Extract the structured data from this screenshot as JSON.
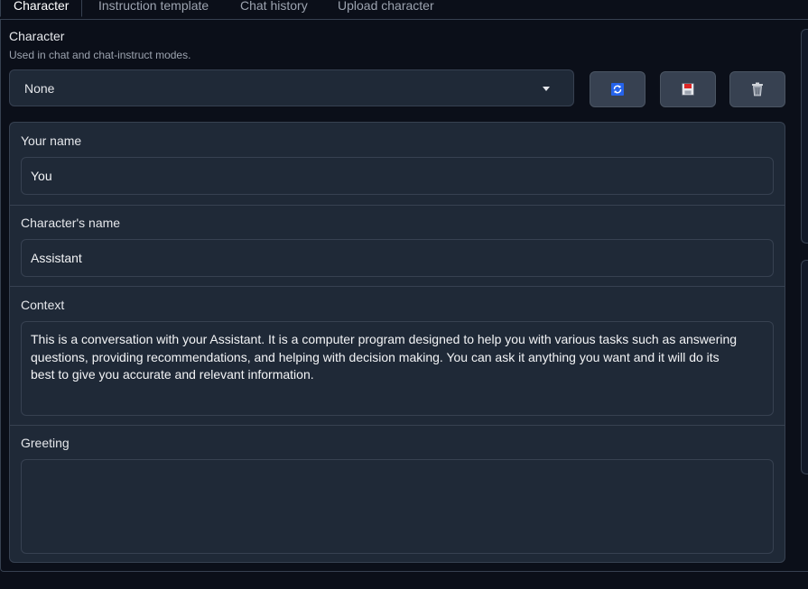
{
  "tabs": [
    {
      "label": "Character",
      "active": true
    },
    {
      "label": "Instruction template",
      "active": false
    },
    {
      "label": "Chat history",
      "active": false
    },
    {
      "label": "Upload character",
      "active": false
    }
  ],
  "character": {
    "label": "Character",
    "info": "Used in chat and chat-instruct modes.",
    "selected": "None"
  },
  "buttons": {
    "refresh_icon": "refresh-icon",
    "save_icon": "floppy-disk-icon",
    "delete_icon": "trash-icon"
  },
  "fields": {
    "your_name": {
      "label": "Your name",
      "value": "You"
    },
    "character_name": {
      "label": "Character's name",
      "value": "Assistant"
    },
    "context": {
      "label": "Context",
      "value": "This is a conversation with your Assistant. It is a computer program designed to help you with various tasks such as answering questions, providing recommendations, and helping with decision making. You can ask it anything you want and it will do its best to give you accurate and relevant information."
    },
    "greeting": {
      "label": "Greeting",
      "value": ""
    }
  },
  "colors": {
    "background": "#0b0f19",
    "surface": "#1f2937",
    "border": "#374151",
    "accent_refresh": "#2563eb",
    "save_red": "#dc2626"
  }
}
